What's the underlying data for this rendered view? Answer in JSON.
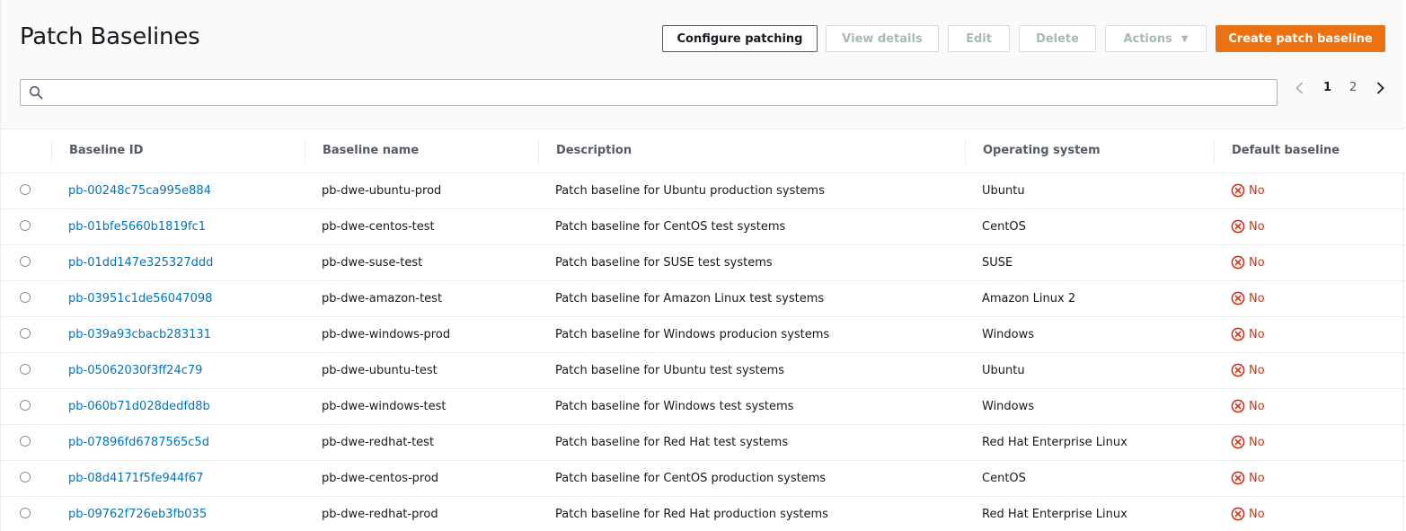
{
  "page": {
    "title": "Patch Baselines"
  },
  "toolbar": {
    "configure_label": "Configure patching",
    "view_details_label": "View details",
    "edit_label": "Edit",
    "delete_label": "Delete",
    "actions_label": "Actions",
    "create_label": "Create patch baseline"
  },
  "search": {
    "value": "",
    "placeholder": ""
  },
  "pagination": {
    "pages": [
      "1",
      "2"
    ],
    "current": "1"
  },
  "table": {
    "columns": [
      "Baseline ID",
      "Baseline name",
      "Description",
      "Operating system",
      "Default baseline"
    ],
    "rows": [
      {
        "id": "pb-00248c75ca995e884",
        "name": "pb-dwe-ubuntu-prod",
        "description": "Patch baseline for Ubuntu production systems",
        "os": "Ubuntu",
        "default": "No"
      },
      {
        "id": "pb-01bfe5660b1819fc1",
        "name": "pb-dwe-centos-test",
        "description": "Patch baseline for CentOS test systems",
        "os": "CentOS",
        "default": "No"
      },
      {
        "id": "pb-01dd147e325327ddd",
        "name": "pb-dwe-suse-test",
        "description": "Patch baseline for SUSE test systems",
        "os": "SUSE",
        "default": "No"
      },
      {
        "id": "pb-03951c1de56047098",
        "name": "pb-dwe-amazon-test",
        "description": "Patch baseline for Amazon Linux test systems",
        "os": "Amazon Linux 2",
        "default": "No"
      },
      {
        "id": "pb-039a93cbacb283131",
        "name": "pb-dwe-windows-prod",
        "description": "Patch baseline for Windows producion systems",
        "os": "Windows",
        "default": "No"
      },
      {
        "id": "pb-05062030f3ff24c79",
        "name": "pb-dwe-ubuntu-test",
        "description": "Patch baseline for Ubuntu test systems",
        "os": "Ubuntu",
        "default": "No"
      },
      {
        "id": "pb-060b71d028dedfd8b",
        "name": "pb-dwe-windows-test",
        "description": "Patch baseline for Windows test systems",
        "os": "Windows",
        "default": "No"
      },
      {
        "id": "pb-07896fd6787565c5d",
        "name": "pb-dwe-redhat-test",
        "description": "Patch baseline for Red Hat test systems",
        "os": "Red Hat Enterprise Linux",
        "default": "No"
      },
      {
        "id": "pb-08d4171f5fe944f67",
        "name": "pb-dwe-centos-prod",
        "description": "Patch baseline for CentOS production systems",
        "os": "CentOS",
        "default": "No"
      },
      {
        "id": "pb-09762f726eb3fb035",
        "name": "pb-dwe-redhat-prod",
        "description": "Patch baseline for Red Hat production systems",
        "os": "Red Hat Enterprise Linux",
        "default": "No"
      }
    ]
  },
  "colors": {
    "accent": "#ec7211",
    "link": "#0073bb",
    "negative": "#d13212"
  },
  "icons": {
    "search": "search-icon",
    "prev": "chevron-left-icon",
    "next": "chevron-right-icon",
    "no": "x-circle-icon"
  }
}
